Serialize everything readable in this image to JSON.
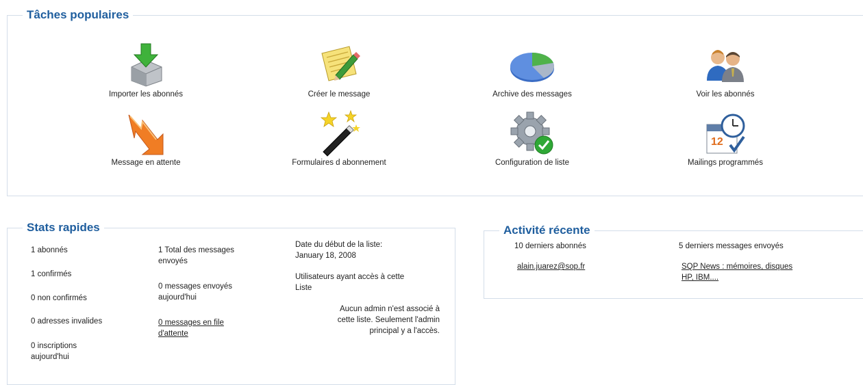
{
  "tasks": {
    "title": "Tâches populaires",
    "items": [
      {
        "label": "Importer les abonnés",
        "icon": "import-icon"
      },
      {
        "label": "Créer le message",
        "icon": "create-message-icon"
      },
      {
        "label": "Archive des messages",
        "icon": "archive-icon"
      },
      {
        "label": "Voir les abonnés",
        "icon": "subscribers-icon"
      },
      {
        "label": "Message en attente",
        "icon": "pending-message-icon"
      },
      {
        "label": "Formulaires d abonnement",
        "icon": "magic-wand-icon"
      },
      {
        "label": "Configuration de liste",
        "icon": "gear-check-icon"
      },
      {
        "label": "Mailings programmés",
        "icon": "calendar-clock-icon"
      }
    ]
  },
  "stats": {
    "title": "Stats rapides",
    "col1": {
      "subscribers": "1 abonnés",
      "confirmed": "1 confirmés",
      "unconfirmed": "0 non confirmés",
      "invalid": "0 adresses invalides",
      "today_l1": "0 inscriptions",
      "today_l2": "aujourd'hui"
    },
    "col2": {
      "total_l1": "1 Total des messages",
      "total_l2": "envoyés",
      "sent_today_l1": "0 messages envoyés",
      "sent_today_l2": "aujourd'hui",
      "queue_l1": "0 messages en file",
      "queue_l2": "d'attente"
    },
    "col3": {
      "start_l1": "Date du début de la liste:",
      "start_l2": "January 18, 2008",
      "users_l1": "Utilisateurs ayant accès à cette",
      "users_l2": "Liste",
      "admin_l1": "Aucun admin n'est associé à",
      "admin_l2": "cette liste. Seulement l'admin",
      "admin_l3": "principal y a l'accès."
    }
  },
  "activity": {
    "title": "Activité récente",
    "last_subscribers_header": "10 derniers abonnés",
    "last_subscriber": "alain.juarez@sop.fr",
    "last_messages_header": "5 derniers messages envoyés",
    "last_message_l1": "SQP News : mémoires, disques",
    "last_message_l2": "HP, IBM...."
  },
  "colors": {
    "legend": "#1f5e9e",
    "border": "#d3dde9"
  }
}
